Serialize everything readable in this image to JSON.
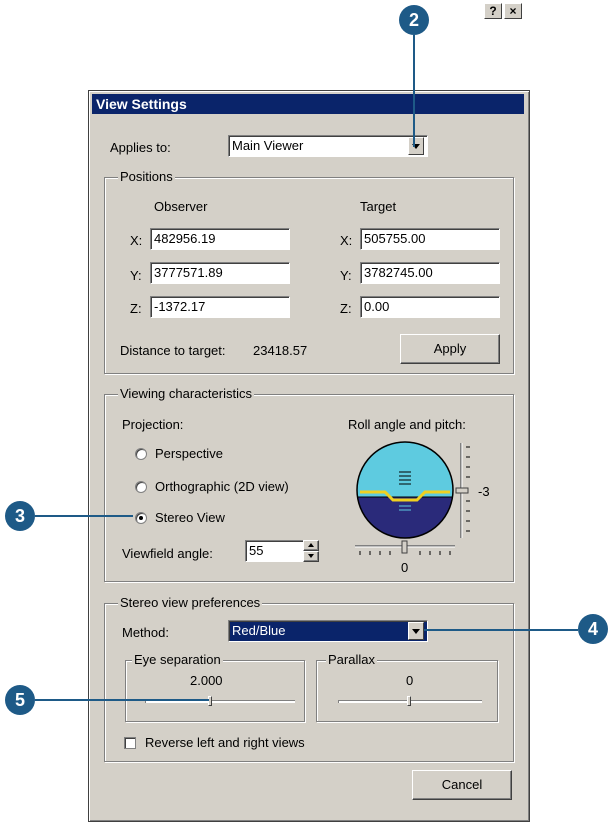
{
  "dialog": {
    "title": "View Settings",
    "help_button": "?",
    "close_button": "×",
    "applies_to_label": "Applies to:",
    "applies_to_value": "Main Viewer"
  },
  "positions": {
    "group_title": "Positions",
    "observer_header": "Observer",
    "target_header": "Target",
    "x_label": "X:",
    "y_label": "Y:",
    "z_label": "Z:",
    "observer_x": "482956.19",
    "observer_y": "3777571.89",
    "observer_z": "-1372.17",
    "target_x": "505755.00",
    "target_y": "3782745.00",
    "target_z": "0.00",
    "distance_label": "Distance to target:",
    "distance_value": "23418.57",
    "apply_button": "Apply"
  },
  "viewing": {
    "group_title": "Viewing characteristics",
    "projection_label": "Projection:",
    "options": [
      "Perspective",
      "Orthographic (2D view)",
      "Stereo View"
    ],
    "selected_option": "Stereo View",
    "roll_label": "Roll angle and pitch:",
    "pitch_value": "-3",
    "roll_value": "0",
    "viewfield_label": "Viewfield angle:",
    "viewfield_value": "55"
  },
  "stereo": {
    "group_title": "Stereo view preferences",
    "method_label": "Method:",
    "method_value": "Red/Blue",
    "eye_sep_title": "Eye separation",
    "eye_sep_value": "2.000",
    "parallax_title": "Parallax",
    "parallax_value": "0",
    "reverse_label": "Reverse left and right views",
    "reverse_checked": false
  },
  "footer": {
    "cancel_button": "Cancel"
  },
  "callouts": {
    "c2": "2",
    "c3": "3",
    "c4": "4",
    "c5": "5"
  },
  "colors": {
    "titlebar": "#0a246a",
    "callout": "#1e5a87",
    "sky": "#5ecbe0",
    "ground": "#2a2a7a",
    "dialog": "#d4d0c8"
  }
}
